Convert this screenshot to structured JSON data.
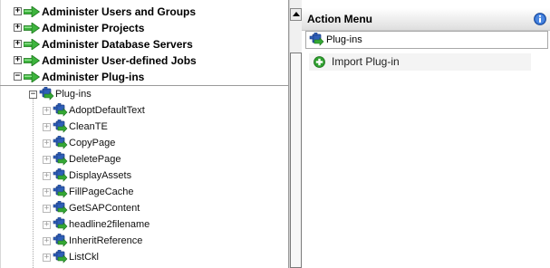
{
  "tree": {
    "top_nodes": [
      {
        "label": "Administer Users and Groups",
        "toggle": "+"
      },
      {
        "label": "Administer Projects",
        "toggle": "+"
      },
      {
        "label": "Administer Database Servers",
        "toggle": "+"
      },
      {
        "label": "Administer User-defined Jobs",
        "toggle": "+"
      },
      {
        "label": "Administer Plug-ins",
        "toggle": "−"
      }
    ],
    "plugins_node": {
      "label": "Plug-ins",
      "toggle": "−"
    },
    "plugins": [
      {
        "label": "AdoptDefaultText",
        "toggle": "+"
      },
      {
        "label": "CleanTE",
        "toggle": "+"
      },
      {
        "label": "CopyPage",
        "toggle": "+"
      },
      {
        "label": "DeletePage",
        "toggle": "+"
      },
      {
        "label": "DisplayAssets",
        "toggle": "+"
      },
      {
        "label": "FillPageCache",
        "toggle": "+"
      },
      {
        "label": "GetSAPContent",
        "toggle": "+"
      },
      {
        "label": "headline2filename",
        "toggle": "+"
      },
      {
        "label": "InheritReference",
        "toggle": "+"
      },
      {
        "label": "ListCkl",
        "toggle": "+"
      }
    ]
  },
  "action_menu": {
    "title": "Action Menu",
    "info_icon": "info-icon",
    "context_label": "Plug-ins",
    "items": [
      {
        "label": "Import Plug-in",
        "icon": "add-icon"
      }
    ]
  },
  "colors": {
    "arrow_green": "#3db43d",
    "plugin_blue": "#2f5fb8",
    "plugin_green": "#34a834",
    "info_blue": "#2a66c8"
  }
}
